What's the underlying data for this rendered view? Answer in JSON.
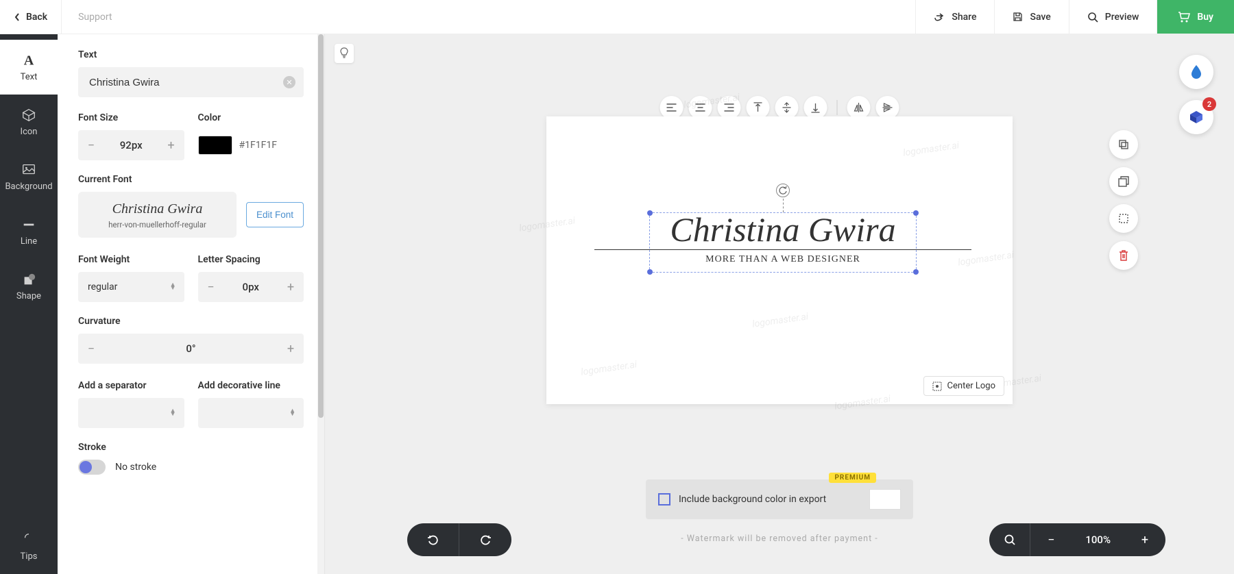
{
  "topbar": {
    "back": "Back",
    "support": "Support",
    "share": "Share",
    "save": "Save",
    "preview": "Preview",
    "buy": "Buy"
  },
  "leftnav": {
    "text": "Text",
    "icon": "Icon",
    "background": "Background",
    "line": "Line",
    "shape": "Shape",
    "tips": "Tips"
  },
  "panel": {
    "text_label": "Text",
    "text_value": "Christina Gwira",
    "font_size_label": "Font Size",
    "font_size_value": "92px",
    "color_label": "Color",
    "color_hex": "#1F1F1F",
    "current_font_label": "Current Font",
    "font_preview": "Christina Gwira",
    "font_name": "herr-von-muellerhoff-regular",
    "edit_font": "Edit Font",
    "font_weight_label": "Font Weight",
    "font_weight_value": "regular",
    "letter_spacing_label": "Letter Spacing",
    "letter_spacing_value": "0px",
    "curvature_label": "Curvature",
    "curvature_value": "0°",
    "separator_label": "Add a separator",
    "decorative_label": "Add decorative line",
    "stroke_label": "Stroke",
    "stroke_value": "No stroke"
  },
  "canvas": {
    "watermark": "logomaster.ai",
    "logo_main": "Christina Gwira",
    "logo_sub": "More Than A Web Designer",
    "center_logo": "Center Logo",
    "export_label": "Include background color in export",
    "premium": "PREMIUM",
    "watermark_note": "- Watermark will be removed after payment -",
    "zoom": "100%"
  },
  "float": {
    "layers_badge": "2"
  }
}
